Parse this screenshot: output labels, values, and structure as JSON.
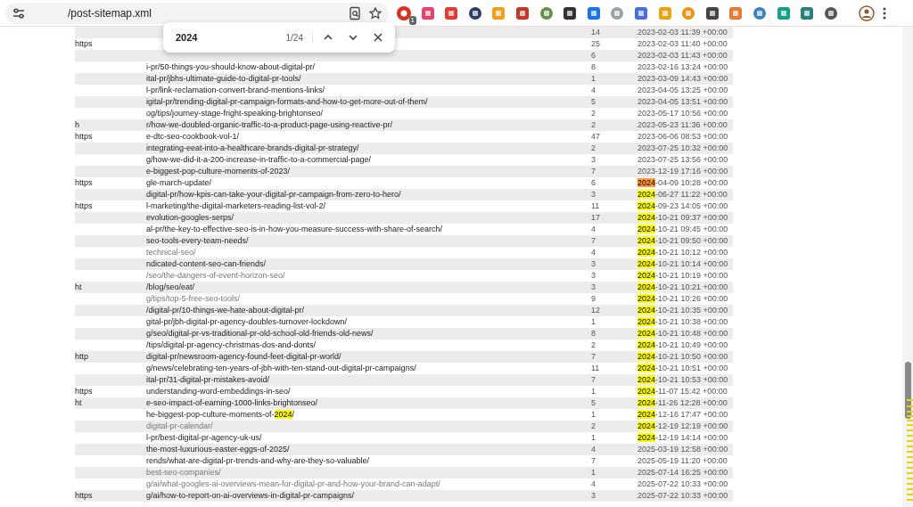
{
  "toolbar": {
    "address": "/post-sitemap.xml",
    "extension_badge": "1"
  },
  "find_bar": {
    "value": "2024",
    "count": "1/24"
  },
  "rows": [
    {
      "prefix": "",
      "url": "",
      "count": "14",
      "date": "2023-02-03 11:39 +00:00"
    },
    {
      "prefix": "https",
      "url": "",
      "count": "25",
      "date": "2023-02-03 11:40 +00:00"
    },
    {
      "prefix": "",
      "url": "",
      "count": "6",
      "date": "2023-02-03 11:43 +00:00"
    },
    {
      "prefix": "",
      "url": "i-pr/50-things-you-should-know-about-digital-pr/",
      "count": "8",
      "date": "2023-02-16 13:24 +00:00"
    },
    {
      "prefix": "",
      "url": "ital-pr/jbhs-ultimate-guide-to-digital-pr-tools/",
      "count": "1",
      "date": "2023-03-09 14:43 +00:00"
    },
    {
      "prefix": "",
      "url": "l-pr/link-reclamation-convert-brand-mentions-links/",
      "count": "4",
      "date": "2023-04-05 13:25 +00:00"
    },
    {
      "prefix": "",
      "url": "igital-pr/trending-digital-pr-campaign-formats-and-how-to-get-more-out-of-them/",
      "count": "5",
      "date": "2023-04-05 13:51 +00:00"
    },
    {
      "prefix": "",
      "url": "og/tips/journey-stage-fright-speaking-brightonseo/",
      "count": "2",
      "date": "2023-05-17 10:56 +00:00"
    },
    {
      "prefix": "h",
      "url": "r/how-we-doubled-organic-traffic-to-a-product-page-using-reactive-pr/",
      "count": "2",
      "date": "2023-05-23 11:36 +00:00"
    },
    {
      "prefix": "https",
      "url": "e-dtc-seo-cookbook-vol-1/",
      "count": "47",
      "date": "2023-06-06 08:53 +00:00"
    },
    {
      "prefix": "",
      "url": "integrating-eeat-into-a-healthcare-brands-digital-pr-strategy/",
      "count": "2",
      "date": "2023-07-25 10:32 +00:00"
    },
    {
      "prefix": "",
      "url": "g/how-we-did-it-a-200-increase-in-traffic-to-a-commercial-page/",
      "count": "3",
      "date": "2023-07-25 13:56 +00:00"
    },
    {
      "prefix": "",
      "url": "e-biggest-pop-culture-moments-of-2023/",
      "count": "7",
      "date": "2023-12-19 17:16 +00:00"
    },
    {
      "prefix": "https",
      "url": "gle-march-update/",
      "count": "6",
      "date": [
        {
          "text": "2024",
          "highlighted": true,
          "current": true
        },
        {
          "text": "-04-09 10:28 +00:00",
          "highlighted": false
        }
      ]
    },
    {
      "prefix": "",
      "url": "digital-pr/how-kpis-can-take-your-digital-pr-campaign-from-zero-to-hero/",
      "count": "3",
      "date": [
        {
          "text": "2024",
          "highlighted": true,
          "current": false
        },
        {
          "text": "-06-27 11:22 +00:00",
          "highlighted": false
        }
      ]
    },
    {
      "prefix": "https",
      "url": "l-marketing/the-digital-marketers-reading-list-vol-2/",
      "count": "11",
      "date": [
        {
          "text": "2024",
          "highlighted": true,
          "current": false
        },
        {
          "text": "-09-23 14:05 +00:00",
          "highlighted": false
        }
      ]
    },
    {
      "prefix": "",
      "url": "evolution-googles-serps/",
      "count": "17",
      "date": [
        {
          "text": "2024",
          "highlighted": true,
          "current": false
        },
        {
          "text": "-10-21 09:37 +00:00",
          "highlighted": false
        }
      ]
    },
    {
      "prefix": "",
      "url": "al-pr/the-key-to-effective-seo-is-in-how-you-measure-success-with-share-of-search/",
      "count": "4",
      "date": [
        {
          "text": "2024",
          "highlighted": true,
          "current": false
        },
        {
          "text": "-10-21 09:45 +00:00",
          "highlighted": false
        }
      ]
    },
    {
      "prefix": "",
      "url": "seo-tools-every-team-needs/",
      "count": "7",
      "date": [
        {
          "text": "2024",
          "highlighted": true,
          "current": false
        },
        {
          "text": "-10-21 09:50 +00:00",
          "highlighted": false
        }
      ]
    },
    {
      "prefix": "",
      "url": "technical-seo/",
      "visited": true,
      "count": "4",
      "date": [
        {
          "text": "2024",
          "highlighted": true,
          "current": false
        },
        {
          "text": "-10-21 10:12 +00:00",
          "highlighted": false
        }
      ]
    },
    {
      "prefix": "",
      "url": "ndicated-content-seo-can-friends/",
      "count": "3",
      "date": [
        {
          "text": "2024",
          "highlighted": true,
          "current": false
        },
        {
          "text": "-10-21 10:14 +00:00",
          "highlighted": false
        }
      ]
    },
    {
      "prefix": "",
      "url": "/seo/the-dangers-of-event-horizon-seo/",
      "visited": true,
      "count": "3",
      "date": [
        {
          "text": "2024",
          "highlighted": true,
          "current": false
        },
        {
          "text": "-10-21 10:19 +00:00",
          "highlighted": false
        }
      ]
    },
    {
      "prefix": "ht",
      "url": "/blog/seo/eat/",
      "count": "3",
      "date": [
        {
          "text": "2024",
          "highlighted": true,
          "current": false
        },
        {
          "text": "-10-21 10:21 +00:00",
          "highlighted": false
        }
      ]
    },
    {
      "prefix": "",
      "url": "g/tips/top-5-free-seo-tools/",
      "visited": true,
      "count": "9",
      "date": [
        {
          "text": "2024",
          "highlighted": true,
          "current": false
        },
        {
          "text": "-10-21 10:26 +00:00",
          "highlighted": false
        }
      ]
    },
    {
      "prefix": "",
      "url": "/digital-pr/10-things-we-hate-about-digital-pr/",
      "count": "12",
      "date": [
        {
          "text": "2024",
          "highlighted": true,
          "current": false
        },
        {
          "text": "-10-21 10:35 +00:00",
          "highlighted": false
        }
      ]
    },
    {
      "prefix": "",
      "url": "gital-pr/jbh-digital-pr-agency-doubles-turnover-lockdown/",
      "count": "1",
      "date": [
        {
          "text": "2024",
          "highlighted": true,
          "current": false
        },
        {
          "text": "-10-21 10:38 +00:00",
          "highlighted": false
        }
      ]
    },
    {
      "prefix": "",
      "url": "g/seo/digital-pr-vs-traditional-pr-old-school-old-friends-old-news/",
      "count": "8",
      "date": [
        {
          "text": "2024",
          "highlighted": true,
          "current": false
        },
        {
          "text": "-10-21 10:48 +00:00",
          "highlighted": false
        }
      ]
    },
    {
      "prefix": "",
      "url": "/tips/digital-pr-agency-christmas-dos-and-donts/",
      "count": "2",
      "date": [
        {
          "text": "2024",
          "highlighted": true,
          "current": false
        },
        {
          "text": "-10-21 10:49 +00:00",
          "highlighted": false
        }
      ]
    },
    {
      "prefix": "http",
      "url": "digital-pr/newsroom-agency-found-feet-digital-pr-world/",
      "count": "7",
      "date": [
        {
          "text": "2024",
          "highlighted": true,
          "current": false
        },
        {
          "text": "-10-21 10:50 +00:00",
          "highlighted": false
        }
      ]
    },
    {
      "prefix": "",
      "url": "g/news/celebrating-ten-years-of-jbh-with-ten-stand-out-digital-pr-campaigns/",
      "count": "11",
      "date": [
        {
          "text": "2024",
          "highlighted": true,
          "current": false
        },
        {
          "text": "-10-21 10:51 +00:00",
          "highlighted": false
        }
      ]
    },
    {
      "prefix": "",
      "url": "ital-pr/31-digital-pr-mistakes-avoid/",
      "count": "7",
      "date": [
        {
          "text": "2024",
          "highlighted": true,
          "current": false
        },
        {
          "text": "-10-21 10:53 +00:00",
          "highlighted": false
        }
      ]
    },
    {
      "prefix": "https",
      "url": "understanding-word-embeddings-in-seo/",
      "count": "1",
      "date": [
        {
          "text": "2024",
          "highlighted": true,
          "current": false
        },
        {
          "text": "-11-07 15:42 +00:00",
          "highlighted": false
        }
      ]
    },
    {
      "prefix": "ht",
      "url": "e-seo-impact-of-earning-1000-links-brightonseo/",
      "count": "5",
      "date": [
        {
          "text": "2024",
          "highlighted": true,
          "current": false
        },
        {
          "text": "-11-26 12:28 +00:00",
          "highlighted": false
        }
      ]
    },
    {
      "prefix": "",
      "url": [
        {
          "text": "he-biggest-pop-culture-moments-of-",
          "highlighted": false
        },
        {
          "text": "2024",
          "highlighted": true,
          "current": false
        },
        {
          "text": "/",
          "highlighted": false
        }
      ],
      "count": "1",
      "date": [
        {
          "text": "2024",
          "highlighted": true,
          "current": false
        },
        {
          "text": "-12-16 17:47 +00:00",
          "highlighted": false
        }
      ]
    },
    {
      "prefix": "",
      "url": "digital-pr-calendar/",
      "visited": true,
      "count": "2",
      "date": [
        {
          "text": "2024",
          "highlighted": true,
          "current": false
        },
        {
          "text": "-12-19 12:19 +00:00",
          "highlighted": false
        }
      ]
    },
    {
      "prefix": "",
      "url": "l-pr/best-digital-pr-agency-uk-us/",
      "count": "1",
      "date": [
        {
          "text": "2024",
          "highlighted": true,
          "current": false
        },
        {
          "text": "-12-19 14:14 +00:00",
          "highlighted": false
        }
      ]
    },
    {
      "prefix": "",
      "url": "the-most-luxurious-easter-eggs-of-2025/",
      "count": "4",
      "date": "2025-03-19 12:58 +00:00"
    },
    {
      "prefix": "",
      "url": "rends/what-are-digital-pr-trends-and-why-are-they-so-valuable/",
      "count": "7",
      "date": "2025-05-19 11:20 +00:00"
    },
    {
      "prefix": "",
      "url": "best-seo-companies/",
      "visited": true,
      "count": "1",
      "date": "2025-07-14 16:25 +00:00"
    },
    {
      "prefix": "",
      "url": "g/ai/what-googles-ai-overviews-mean-for-digital-pr-and-how-your-brand-can-adapt/",
      "visited": true,
      "count": "4",
      "date": "2025-07-22 10:33 +00:00"
    },
    {
      "prefix": "https",
      "url": "g/ai/how-to-report-on-ai-overviews-in-digital-pr-campaigns/",
      "count": "3",
      "date": "2025-07-22 10:33 +00:00"
    }
  ]
}
